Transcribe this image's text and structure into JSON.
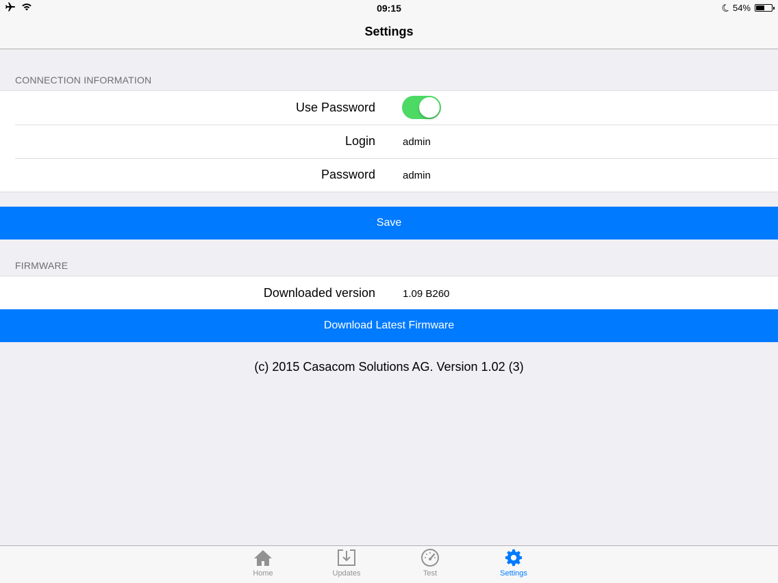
{
  "status_bar": {
    "time": "09:15",
    "battery_percent": "54%",
    "battery_level": 0.54,
    "icons": [
      "airplane-icon",
      "wifi-icon",
      "moon-icon",
      "battery-icon"
    ]
  },
  "nav": {
    "title": "Settings"
  },
  "connection": {
    "header": "CONNECTION INFORMATION",
    "use_password_label": "Use Password",
    "use_password_on": true,
    "login_label": "Login",
    "login_value": "admin",
    "password_label": "Password",
    "password_value": "admin"
  },
  "save_button": "Save",
  "firmware": {
    "header": "FIRMWARE",
    "downloaded_label": "Downloaded version",
    "downloaded_value": "1.09 B260",
    "download_button": "Download Latest Firmware"
  },
  "footer": "(c) 2015 Casacom Solutions AG. Version 1.02 (3)",
  "tabs": [
    {
      "label": "Home",
      "icon": "home-icon"
    },
    {
      "label": "Updates",
      "icon": "download-icon"
    },
    {
      "label": "Test",
      "icon": "speedometer-icon"
    },
    {
      "label": "Settings",
      "icon": "gear-icon"
    }
  ],
  "colors": {
    "accent": "#007aff",
    "toggle_on": "#4cd964",
    "background": "#efeff4"
  }
}
